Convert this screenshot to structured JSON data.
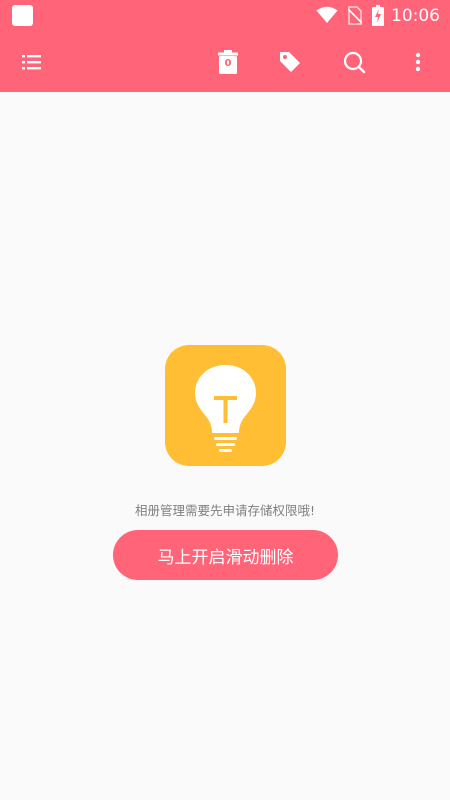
{
  "status_bar": {
    "time": "10:06",
    "icons": [
      "app-notification-icon",
      "wifi-icon",
      "no-sim-icon",
      "battery-charging-icon"
    ]
  },
  "toolbar": {
    "icons": [
      "menu-list-icon",
      "trash-icon",
      "tag-icon",
      "search-icon",
      "more-vert-icon"
    ],
    "trash_count": "0"
  },
  "empty_state": {
    "icon": "lightbulb-icon",
    "message": "相册管理需要先申请存储权限哦!",
    "button_label": "马上开启滑动删除"
  },
  "colors": {
    "primary": "#ff6478",
    "bulb_card": "#ffbe33",
    "background": "#fafafa",
    "message_text": "#808080"
  }
}
